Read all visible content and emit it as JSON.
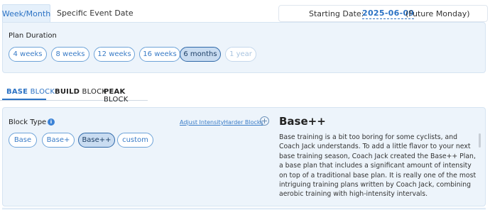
{
  "top_tabs": {
    "week_month": "Week/Month",
    "specific_event": "Specific Event Date"
  },
  "start": {
    "label": "Starting Date:",
    "date": "2025-06-09",
    "note": "(Future Monday)"
  },
  "plan_duration": {
    "label": "Plan Duration",
    "options": [
      "4 weeks",
      "8 weeks",
      "12 weeks",
      "16 weeks",
      "6 months",
      "1 year"
    ],
    "selected": "6 months",
    "disabled": "1 year"
  },
  "block_tabs": [
    {
      "bold": "BASE",
      "rest": "BLOCK"
    },
    {
      "bold": "BUILD",
      "rest": "BLOCK"
    },
    {
      "bold": "PEAK",
      "rest": "BLOCK"
    }
  ],
  "block_type": {
    "label": "Block Type",
    "info_icon": "i",
    "adjust_link": "Adjust Intensity",
    "harder_link": "Harder Blocks",
    "plus_icon": "+",
    "options": [
      "Base",
      "Base+",
      "Base++",
      "custom"
    ],
    "selected": "Base++"
  },
  "description": {
    "title": "Base++",
    "text": "Base training is a bit too boring for some cyclists, and Coach Jack understands. To add a little flavor to your next base training season, Coach Jack created the Base++ Plan, a base plan that includes a significant amount of intensity on top of a traditional base plan. It is really one of the most intriguing training plans written by Coach Jack, combining aerobic training with high-intensity intervals."
  },
  "colors": {
    "accent": "#2b72c4",
    "panel_bg": "#edf4fb",
    "selected_pill": "#c9dcf1"
  }
}
